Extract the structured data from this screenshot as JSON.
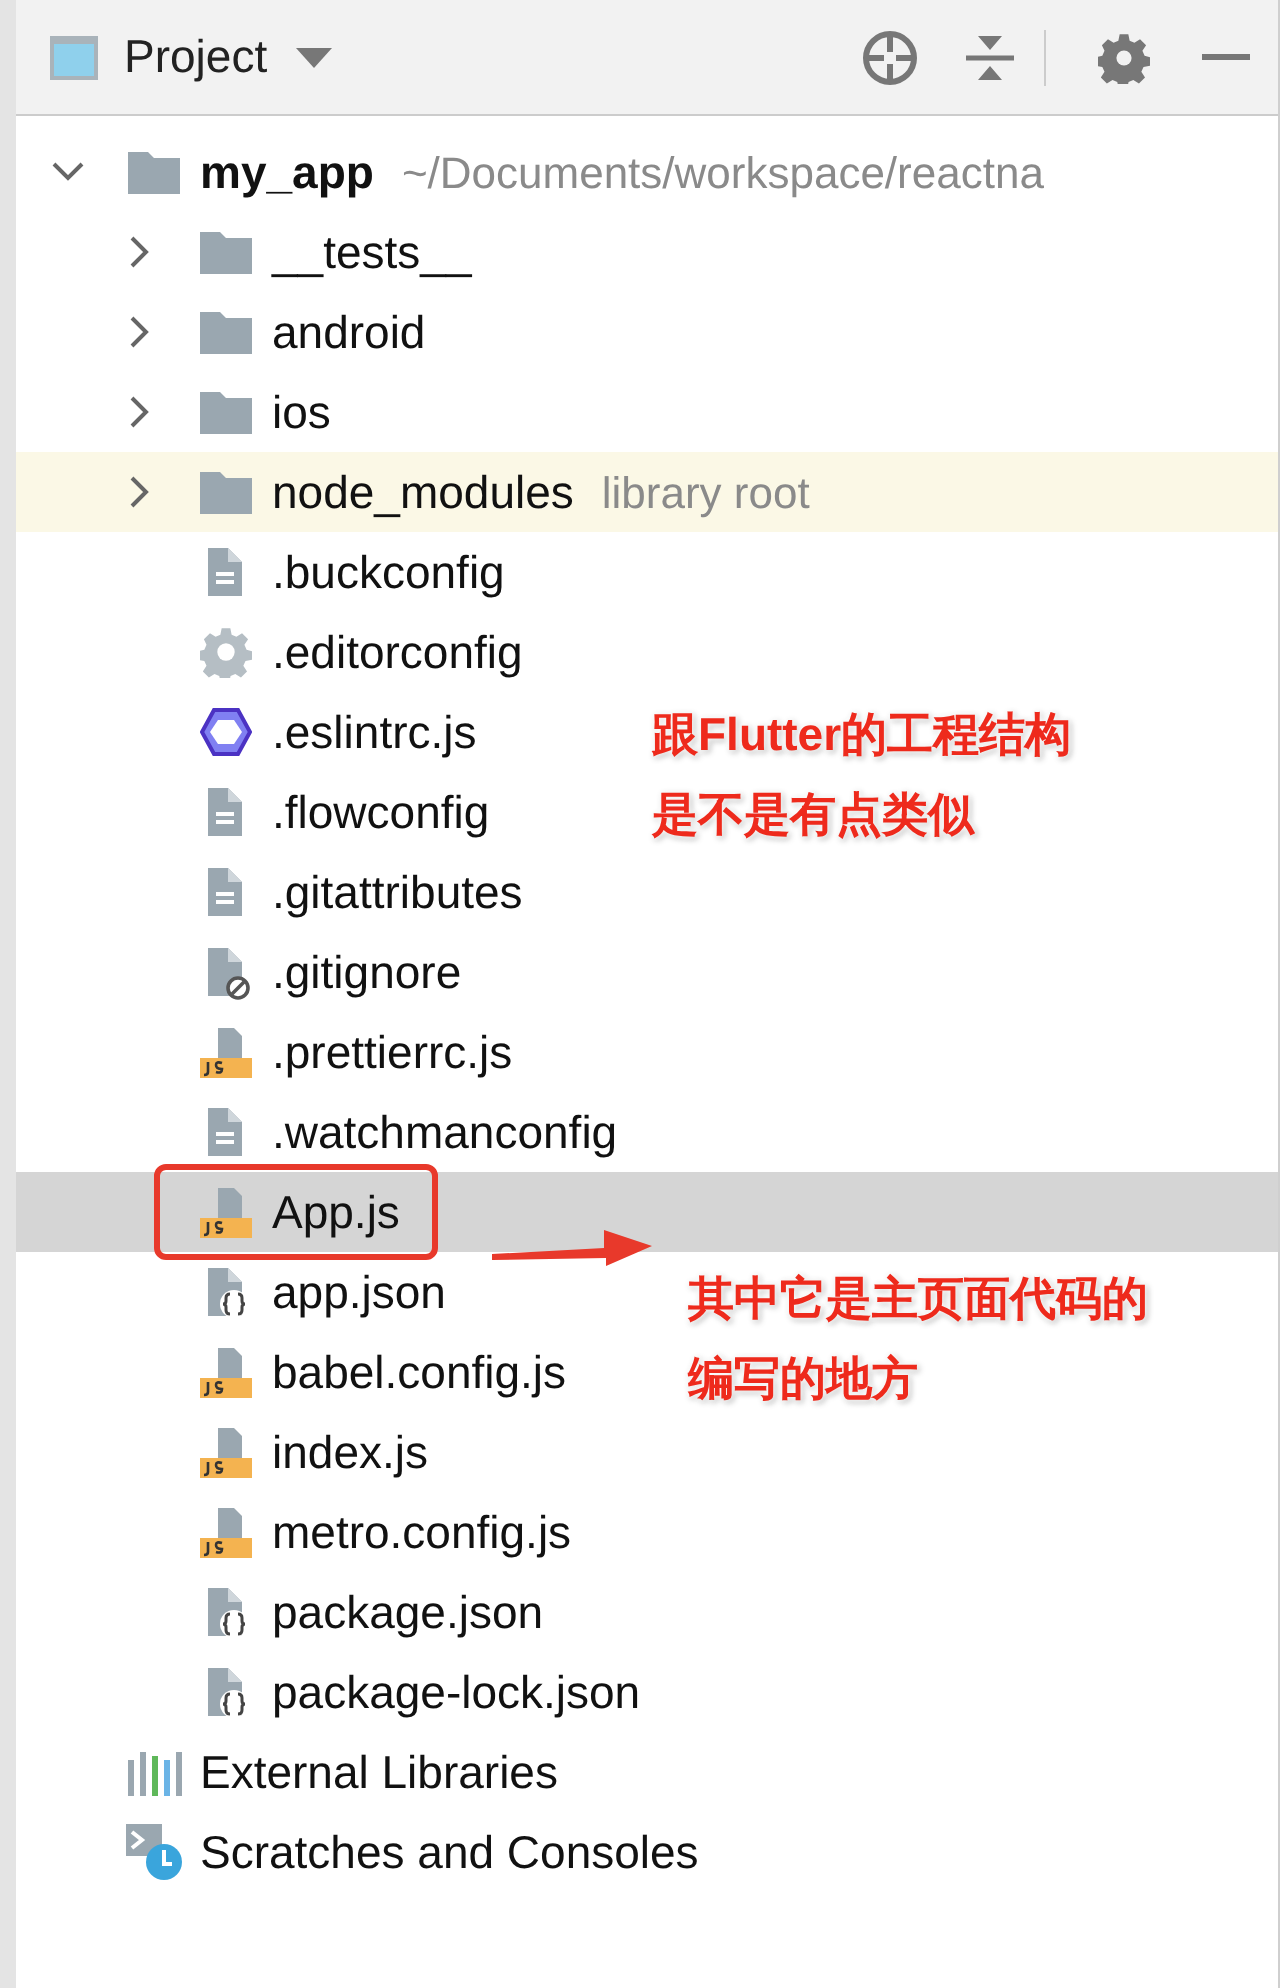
{
  "panel": {
    "title": "Project"
  },
  "tree": [
    {
      "name": "my_app",
      "kind": "folder",
      "expanded": true,
      "selected": false,
      "highlighted": false,
      "hint": "~/Documents/workspace/reactna",
      "children": [
        {
          "name": "__tests__",
          "kind": "folder",
          "expanded": false,
          "selected": false,
          "highlighted": false
        },
        {
          "name": "android",
          "kind": "folder",
          "expanded": false,
          "selected": false,
          "highlighted": false
        },
        {
          "name": "ios",
          "kind": "folder",
          "expanded": false,
          "selected": false,
          "highlighted": false
        },
        {
          "name": "node_modules",
          "kind": "folder",
          "expanded": false,
          "selected": false,
          "highlighted": true,
          "hint": "library root"
        },
        {
          "name": ".buckconfig",
          "kind": "text",
          "selected": false,
          "highlighted": false
        },
        {
          "name": ".editorconfig",
          "kind": "settings",
          "selected": false,
          "highlighted": false
        },
        {
          "name": ".eslintrc.js",
          "kind": "eslint",
          "selected": false,
          "highlighted": false
        },
        {
          "name": ".flowconfig",
          "kind": "text",
          "selected": false,
          "highlighted": false
        },
        {
          "name": ".gitattributes",
          "kind": "text",
          "selected": false,
          "highlighted": false
        },
        {
          "name": ".gitignore",
          "kind": "ignore",
          "selected": false,
          "highlighted": false
        },
        {
          "name": ".prettierrc.js",
          "kind": "js",
          "selected": false,
          "highlighted": false
        },
        {
          "name": ".watchmanconfig",
          "kind": "text",
          "selected": false,
          "highlighted": false
        },
        {
          "name": "App.js",
          "kind": "js",
          "selected": true,
          "highlighted": false,
          "boxed": true
        },
        {
          "name": "app.json",
          "kind": "json",
          "selected": false,
          "highlighted": false
        },
        {
          "name": "babel.config.js",
          "kind": "js",
          "selected": false,
          "highlighted": false
        },
        {
          "name": "index.js",
          "kind": "js",
          "selected": false,
          "highlighted": false
        },
        {
          "name": "metro.config.js",
          "kind": "js",
          "selected": false,
          "highlighted": false
        },
        {
          "name": "package.json",
          "kind": "json",
          "selected": false,
          "highlighted": false
        },
        {
          "name": "package-lock.json",
          "kind": "json",
          "selected": false,
          "highlighted": false
        }
      ]
    },
    {
      "name": "External Libraries",
      "kind": "libraries",
      "selected": false,
      "highlighted": false
    },
    {
      "name": "Scratches and Consoles",
      "kind": "scratches",
      "selected": false,
      "highlighted": false
    }
  ],
  "notes": [
    {
      "lines": [
        "跟Flutter的工程结构",
        "是不是有点类似"
      ]
    },
    {
      "lines": [
        "其中它是主页面代码的",
        "编写的地方"
      ],
      "arrow": true
    }
  ]
}
